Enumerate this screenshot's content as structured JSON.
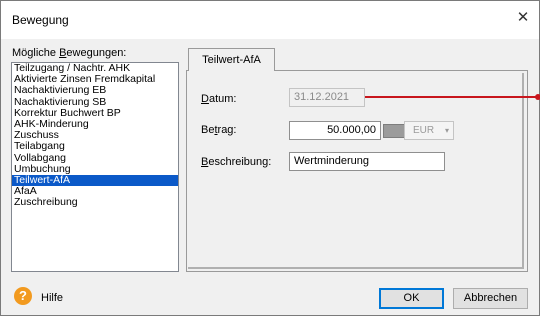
{
  "window": {
    "title": "Bewegung",
    "close_glyph": "✕"
  },
  "list": {
    "label_prefix": "Mögliche ",
    "label_mnemonic": "B",
    "label_rest": "ewegungen:",
    "items": [
      "Teilzugang / Nachtr. AHK",
      "Aktivierte Zinsen Fremdkapital",
      "Nachaktivierung EB",
      "Nachaktivierung SB",
      "Korrektur Buchwert BP",
      "AHK-Minderung",
      "Zuschuss",
      "Teilabgang",
      "Vollabgang",
      "Umbuchung",
      "Teilwert-AfA",
      "AfaA",
      "Zuschreibung"
    ],
    "selected": "Teilwert-AfA"
  },
  "tab": {
    "label": "Teilwert-AfA"
  },
  "form": {
    "datum": {
      "mnemonic": "D",
      "label_rest": "atum:",
      "value": "31.12.2021"
    },
    "betrag": {
      "label_a": "Be",
      "mnemonic": "t",
      "label_b": "rag:",
      "value": "50.000,00",
      "currency": "EUR",
      "currency_caret": "▾"
    },
    "beschreibung": {
      "mnemonic": "B",
      "label_rest": "eschreibung:",
      "value": "Wertminderung"
    }
  },
  "footer": {
    "help_icon": "question-icon",
    "help_glyph": "?",
    "help_label": "Hilfe",
    "ok_label": "OK",
    "cancel_label": "Abbrechen"
  },
  "colors": {
    "selection": "#0b59c8",
    "annotation_line": "#c8161d",
    "help_icon": "#f29a1f",
    "default_button_border": "#0078d7"
  }
}
